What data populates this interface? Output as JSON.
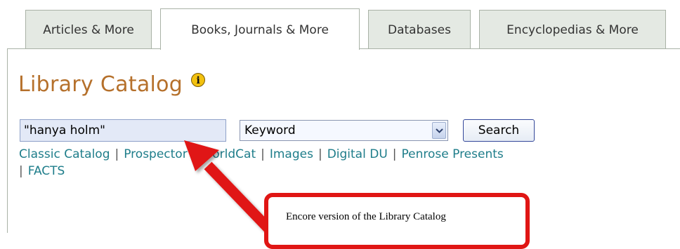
{
  "tabs": [
    {
      "label": "Articles & More",
      "active": false
    },
    {
      "label": "Books, Journals & More",
      "active": true
    },
    {
      "label": "Databases",
      "active": false
    },
    {
      "label": "Encyclopedias & More",
      "active": false
    }
  ],
  "main": {
    "title": "Library Catalog",
    "info_icon_glyph": "i"
  },
  "search": {
    "query": "\"hanya holm\"",
    "field_selected": "Keyword",
    "button_label": "Search"
  },
  "links": {
    "items": [
      "Classic Catalog",
      "Prospector",
      "WorldCat",
      "Images",
      "Digital DU",
      "Penrose Presents",
      "FACTS"
    ],
    "separator": "|"
  },
  "annotation": {
    "callout_text": "Encore version of the Library Catalog",
    "arrow_color": "#e01614"
  },
  "colors": {
    "title": "#b5702b",
    "link": "#1e7d8a",
    "tab_inactive_bg": "#e4e9e3",
    "input_bg": "#e3e9f7"
  }
}
